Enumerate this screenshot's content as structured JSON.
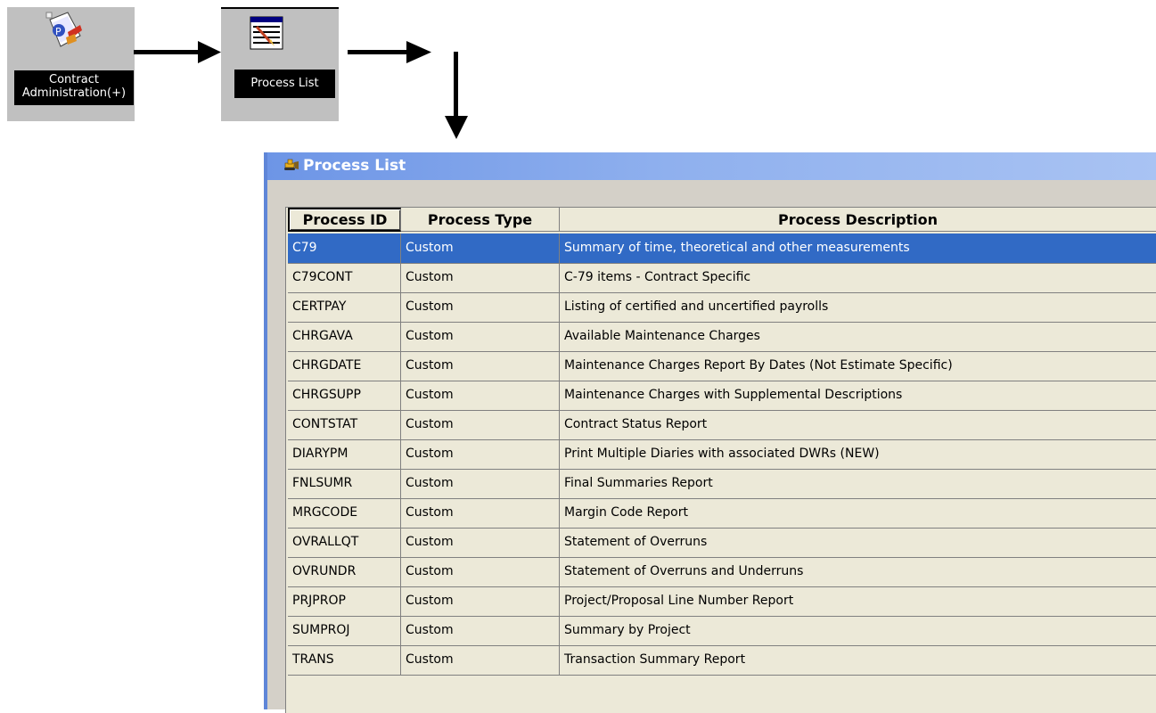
{
  "desktop": {
    "contract_admin_label_line1": "Contract",
    "contract_admin_label_line2": "Administration(+)",
    "process_list_label": "Process List"
  },
  "window": {
    "title": "Process List",
    "columns": [
      "Process ID",
      "Process Type",
      "Process Description"
    ],
    "selected_row": 0,
    "rows": [
      {
        "id": "C79",
        "type": "Custom",
        "desc": "Summary of time, theoretical and other measurements"
      },
      {
        "id": "C79CONT",
        "type": "Custom",
        "desc": "C-79 items - Contract Specific"
      },
      {
        "id": "CERTPAY",
        "type": "Custom",
        "desc": "Listing of certified and uncertified payrolls"
      },
      {
        "id": "CHRGAVA",
        "type": "Custom",
        "desc": "Available Maintenance Charges"
      },
      {
        "id": "CHRGDATE",
        "type": "Custom",
        "desc": "Maintenance Charges Report By Dates (Not Estimate Specific)"
      },
      {
        "id": "CHRGSUPP",
        "type": "Custom",
        "desc": "Maintenance Charges with Supplemental Descriptions"
      },
      {
        "id": "CONTSTAT",
        "type": "Custom",
        "desc": "Contract Status Report"
      },
      {
        "id": "DIARYPM",
        "type": "Custom",
        "desc": "Print Multiple Diaries with associated DWRs (NEW)"
      },
      {
        "id": "FNLSUMR",
        "type": "Custom",
        "desc": "Final Summaries Report"
      },
      {
        "id": "MRGCODE",
        "type": "Custom",
        "desc": "Margin Code Report"
      },
      {
        "id": "OVRALLQT",
        "type": "Custom",
        "desc": "Statement of Overruns"
      },
      {
        "id": "OVRUNDR",
        "type": "Custom",
        "desc": "Statement of Overruns and Underruns"
      },
      {
        "id": "PRJPROP",
        "type": "Custom",
        "desc": "Project/Proposal Line Number Report"
      },
      {
        "id": "SUMPROJ",
        "type": "Custom",
        "desc": "Summary by Project"
      },
      {
        "id": "TRANS",
        "type": "Custom",
        "desc": "Transaction Summary Report"
      }
    ]
  },
  "colors": {
    "selection": "#316ac5",
    "titlebar": "#7aa0ea",
    "grid_bg": "#ece9d8"
  }
}
